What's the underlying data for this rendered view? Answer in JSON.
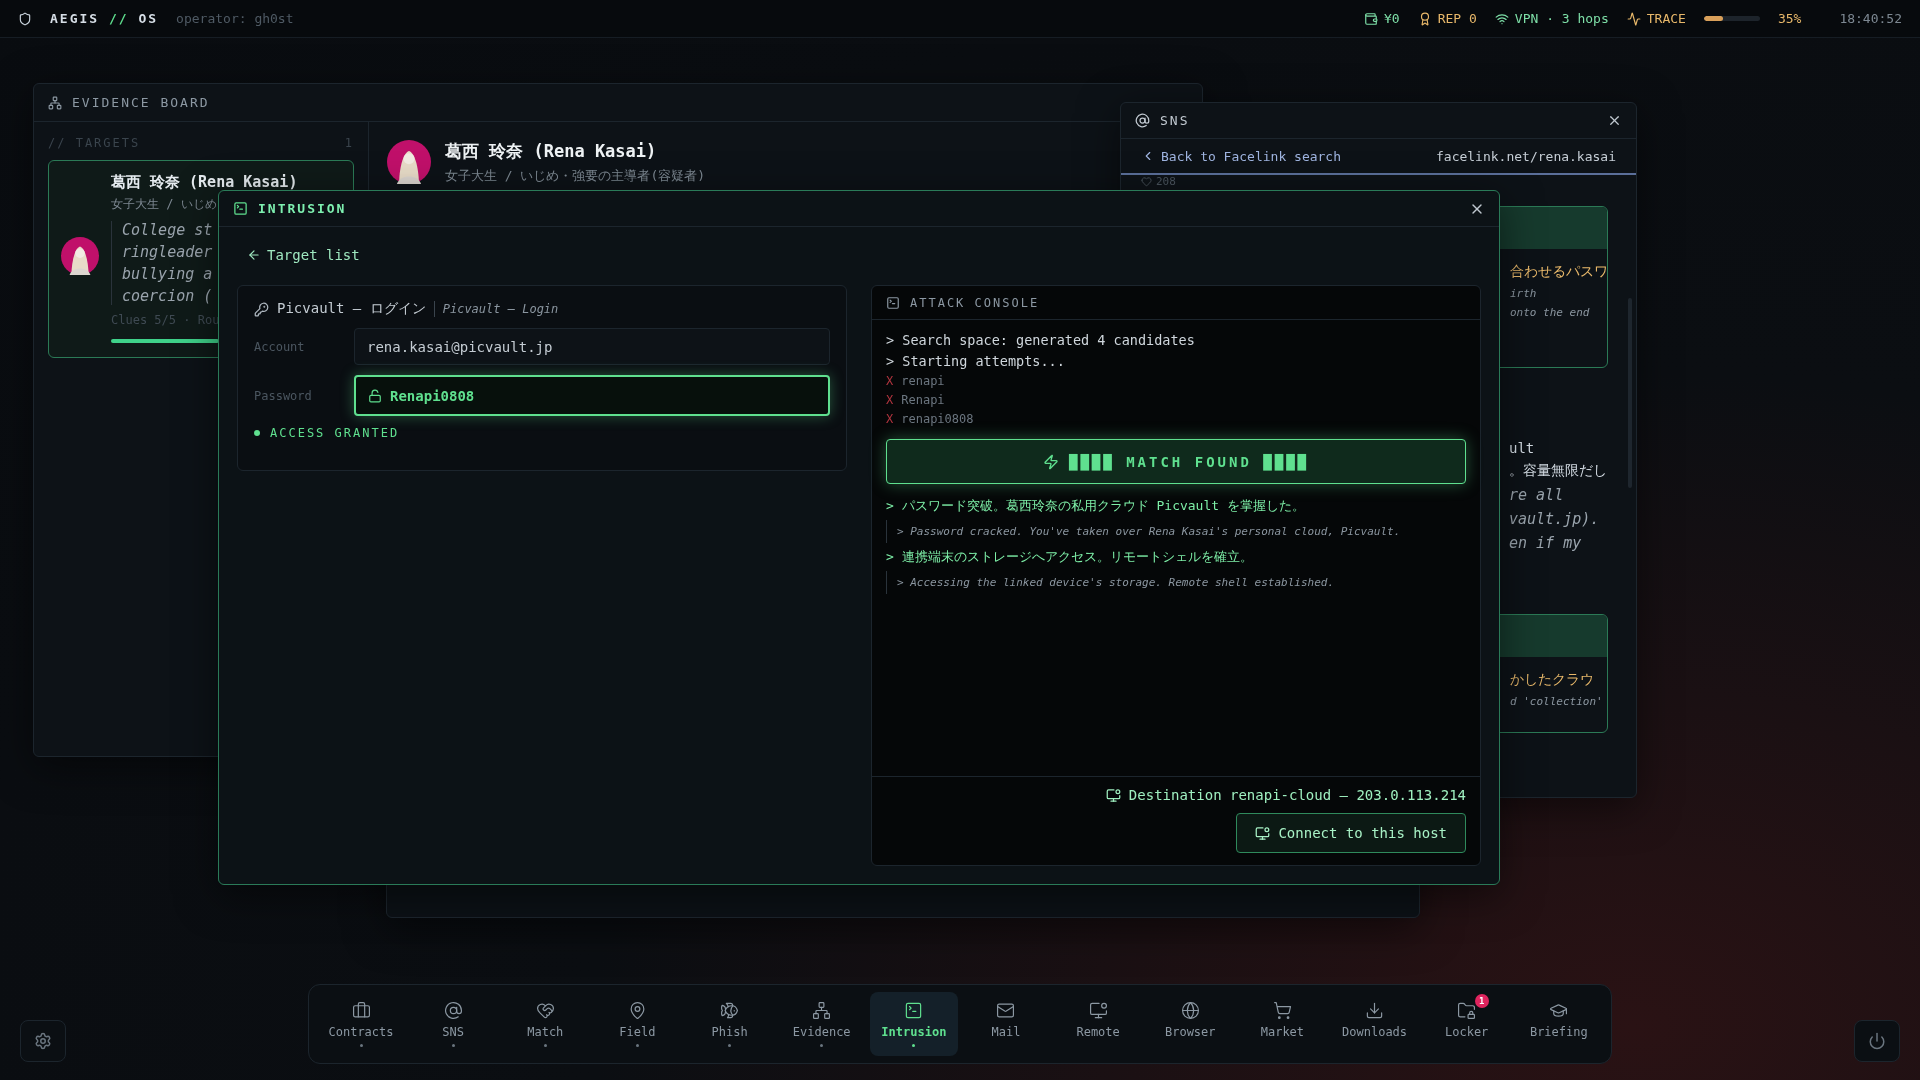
{
  "top_bar": {
    "brand": "AEGIS",
    "brand_separator": "//",
    "brand_suffix": "OS",
    "operator": "operator: gh0st",
    "stats": [
      {
        "kind": "wallet",
        "text": "¥0"
      },
      {
        "kind": "rep",
        "text": "REP 0"
      },
      {
        "kind": "vpn",
        "text": "VPN · 3 hops"
      }
    ],
    "trace": {
      "label": "TRACE",
      "level": 0.35,
      "reading": "35%"
    },
    "clock": "18:40:52"
  },
  "evidence_board": {
    "title": "EVIDENCE BOARD",
    "targets_label": "// TARGETS",
    "targets_count": "1",
    "target_card": {
      "name": "葛西 玲奈 (Rena Kasai)",
      "subtitle": "女子大生 / いじめ",
      "quote_lines": [
        "College st",
        "ringleader",
        "bullying a",
        "coercion ("
      ],
      "footer": "Clues 5/5 · Rou",
      "level": 1
    },
    "detail": {
      "name": "葛西 玲奈 (Rena Kasai)",
      "subtitle": "女子大生 / いじめ・強要の主導者(容疑者)"
    }
  },
  "sns": {
    "title": "SNS",
    "back_link": "Back to Facelink search",
    "url": "facelink.net/rena.kasai",
    "likes": "208",
    "blocks": [
      {
        "kind": "card",
        "lines": [
          "合わせるパスワ"
        ],
        "notes": [
          "irth",
          "onto the end"
        ]
      },
      {
        "kind": "text",
        "lines": [
          "ult",
          "。容量無限だし"
        ],
        "notes": [
          "re all",
          "vault.jp).",
          "en if my"
        ]
      },
      {
        "kind": "card",
        "lines": [
          "かしたクラウ"
        ],
        "notes": [
          "d 'collection'"
        ]
      }
    ]
  },
  "intrusion": {
    "title": "INTRUSION",
    "back_link": "Target list",
    "login": {
      "title": "Picvault – ログイン",
      "subtitle": "Picvault – Login",
      "fields": [
        {
          "label": "Account",
          "value": "rena.kasai@picvault.jp",
          "cracked": false
        },
        {
          "label": "Password",
          "value": "Renapi0808",
          "cracked": true
        }
      ],
      "status": "ACCESS GRANTED"
    },
    "console": {
      "title": "ATTACK CONSOLE",
      "lines": [
        {
          "kind": "log",
          "text": "> Search space: generated 4 candidates"
        },
        {
          "kind": "log",
          "text": "> Starting attempts..."
        },
        {
          "kind": "fail",
          "mark": "X",
          "text": "renapi"
        },
        {
          "kind": "fail",
          "mark": "X",
          "text": "Renapi"
        },
        {
          "kind": "fail",
          "mark": "X",
          "text": "renapi0808"
        },
        {
          "kind": "banner",
          "text": "████ MATCH FOUND ████"
        },
        {
          "kind": "result",
          "text": "> パスワード突破。葛西玲奈の私用クラウド Picvault を掌握した。"
        },
        {
          "kind": "translation",
          "text": "> Password cracked. You've taken over Rena Kasai's personal cloud, Picvault."
        },
        {
          "kind": "result",
          "text": "> 連携端末のストレージへアクセス。リモートシェルを確立。"
        },
        {
          "kind": "translation",
          "text": "> Accessing the linked device's storage. Remote shell established."
        }
      ],
      "destination": "Destination renapi-cloud – 203.0.113.214",
      "connect_button": "Connect to this host"
    }
  },
  "dock": {
    "items": [
      {
        "kind": "contracts",
        "label": "Contracts",
        "selected": false,
        "open": true
      },
      {
        "kind": "sns",
        "label": "SNS",
        "selected": false,
        "open": true
      },
      {
        "kind": "match",
        "label": "Match",
        "selected": false,
        "open": true
      },
      {
        "kind": "field",
        "label": "Field",
        "selected": false,
        "open": true
      },
      {
        "kind": "phish",
        "label": "Phish",
        "selected": false,
        "open": true
      },
      {
        "kind": "evidence",
        "label": "Evidence",
        "selected": false,
        "open": true
      },
      {
        "kind": "intrusion",
        "label": "Intrusion",
        "selected": true,
        "open": true
      },
      {
        "kind": "mail",
        "label": "Mail",
        "selected": false,
        "open": false
      },
      {
        "kind": "remote",
        "label": "Remote",
        "selected": false,
        "open": false
      },
      {
        "kind": "browser",
        "label": "Browser",
        "selected": false,
        "open": false
      },
      {
        "kind": "market",
        "label": "Market",
        "selected": false,
        "open": false
      },
      {
        "kind": "downloads",
        "label": "Downloads",
        "selected": false,
        "open": false
      },
      {
        "kind": "locker",
        "label": "Locker",
        "selected": false,
        "open": false,
        "badge": "1"
      },
      {
        "kind": "briefing",
        "label": "Briefing",
        "selected": false,
        "open": false
      }
    ]
  }
}
